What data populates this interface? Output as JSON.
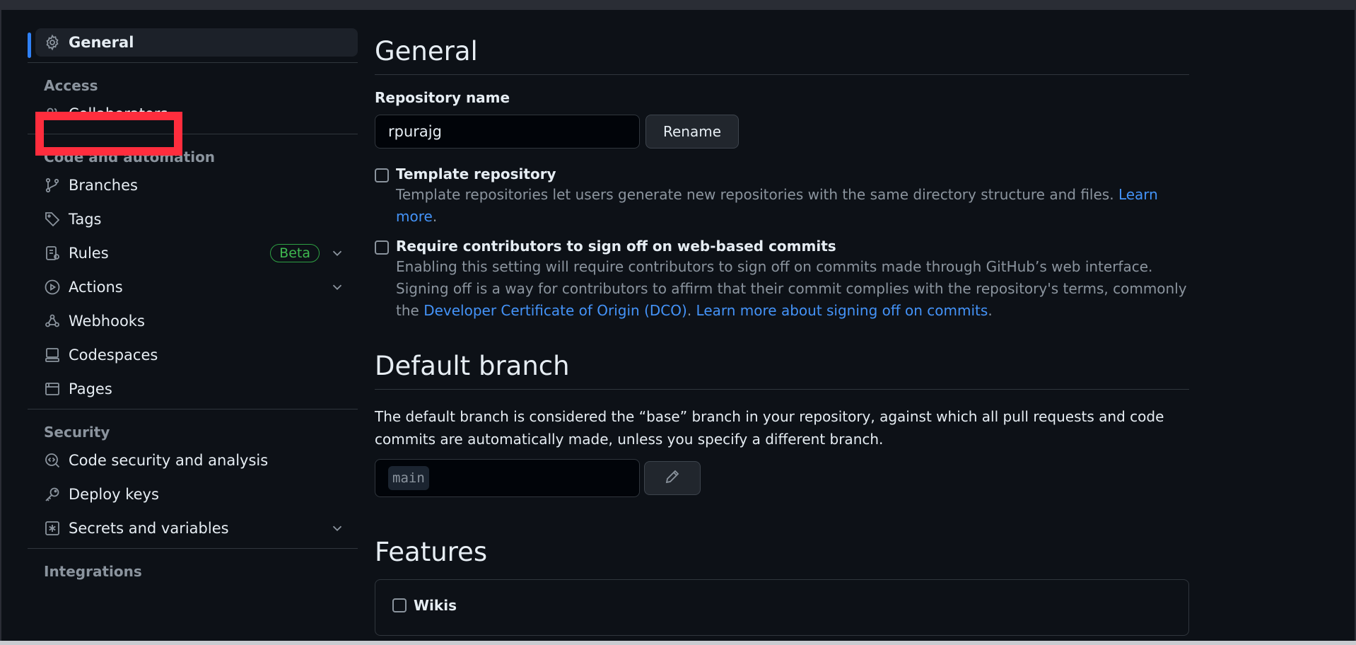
{
  "sidebar": {
    "general": {
      "label": "General",
      "icon": "gear-icon"
    },
    "groups": [
      {
        "title": "Access",
        "items": [
          {
            "label": "Collaborators",
            "icon": "people-icon"
          }
        ]
      },
      {
        "title": "Code and automation",
        "items": [
          {
            "label": "Branches",
            "icon": "git-branch-icon"
          },
          {
            "label": "Tags",
            "icon": "tag-icon"
          },
          {
            "label": "Rules",
            "icon": "rules-icon",
            "badge": "Beta",
            "expandable": true
          },
          {
            "label": "Actions",
            "icon": "play-icon",
            "expandable": true
          },
          {
            "label": "Webhooks",
            "icon": "webhook-icon"
          },
          {
            "label": "Codespaces",
            "icon": "codespaces-icon"
          },
          {
            "label": "Pages",
            "icon": "browser-icon"
          }
        ]
      },
      {
        "title": "Security",
        "items": [
          {
            "label": "Code security and analysis",
            "icon": "codescan-icon"
          },
          {
            "label": "Deploy keys",
            "icon": "key-icon"
          },
          {
            "label": "Secrets and variables",
            "icon": "asterisk-icon",
            "expandable": true
          }
        ]
      },
      {
        "title": "Integrations",
        "items": []
      }
    ]
  },
  "main": {
    "general_title": "General",
    "repo_name_label": "Repository name",
    "repo_name_value": "rpurajg",
    "rename_button": "Rename",
    "template": {
      "title": "Template repository",
      "desc": "Template repositories let users generate new repositories with the same directory structure and files. ",
      "link": "Learn more",
      "end": "."
    },
    "signoff": {
      "title": "Require contributors to sign off on web-based commits",
      "desc1": "Enabling this setting will require contributors to sign off on commits made through GitHub’s web interface. Signing off is a way for contributors to affirm that their commit complies with the repository's terms, commonly the ",
      "link1": "Developer Certificate of Origin (DCO)",
      "mid": ". ",
      "link2": "Learn more about signing off on commits",
      "end": "."
    },
    "default_branch_title": "Default branch",
    "default_branch_desc": "The default branch is considered the “base” branch in your repository, against which all pull requests and code commits are automatically made, unless you specify a different branch.",
    "default_branch_value": "main",
    "features_title": "Features",
    "wikis_label": "Wikis"
  },
  "colors": {
    "accent": "#2f81f7",
    "link": "#4493f8",
    "highlight": "#ff2d3d",
    "beta": "#3fb950"
  }
}
